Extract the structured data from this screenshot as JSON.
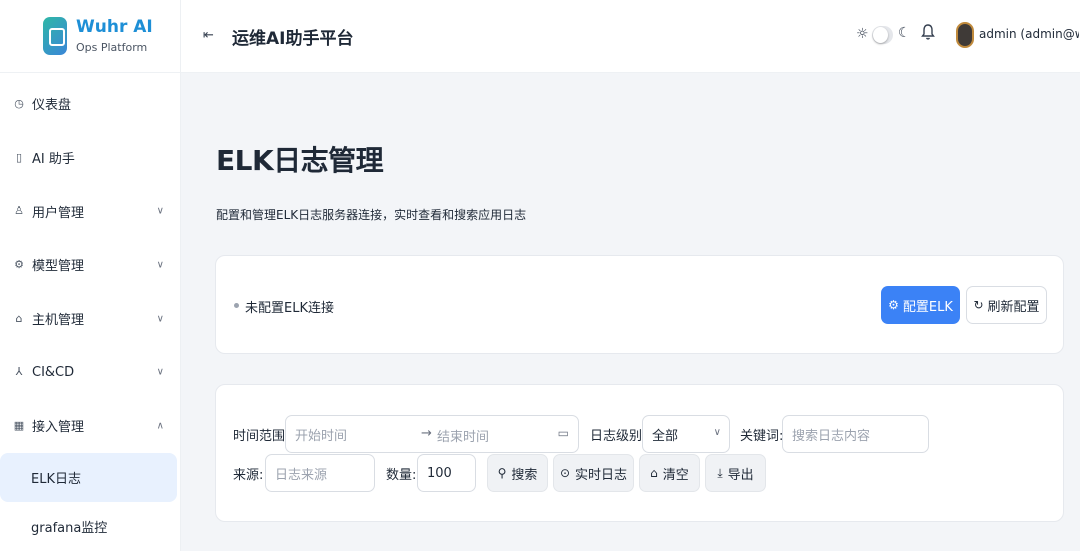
{
  "brand": {
    "title": "Wuhr AI",
    "subtitle": "Ops Platform"
  },
  "header": {
    "title": "运维AI助手平台",
    "user": "admin (admin@w..."
  },
  "sidebar": {
    "items": [
      {
        "label": "仪表盘",
        "icon": "dashboard-icon"
      },
      {
        "label": "AI 助手",
        "icon": "robot-icon"
      },
      {
        "label": "用户管理",
        "icon": "user-icon"
      },
      {
        "label": "模型管理",
        "icon": "model-icon"
      },
      {
        "label": "主机管理",
        "icon": "host-icon"
      },
      {
        "label": "CI&CD",
        "icon": "pipeline-icon"
      },
      {
        "label": "接入管理",
        "icon": "integration-icon"
      }
    ],
    "subitems": [
      {
        "label": "ELK日志",
        "active": true
      },
      {
        "label": "grafana监控",
        "active": false
      }
    ]
  },
  "page": {
    "title": "ELK日志管理",
    "subtitle": "配置和管理ELK日志服务器连接，实时查看和搜索应用日志"
  },
  "connection": {
    "status": "未配置ELK连接",
    "configure_label": "配置ELK",
    "refresh_label": "刷新配置"
  },
  "filters": {
    "time_label": "时间范围:",
    "start_placeholder": "开始时间",
    "end_placeholder": "结束时间",
    "level_label": "日志级别:",
    "level_value": "全部",
    "keyword_label": "关键词:",
    "keyword_placeholder": "搜索日志内容",
    "source_label": "来源:",
    "source_placeholder": "日志来源",
    "qty_label": "数量:",
    "qty_value": "100",
    "search_label": "搜索",
    "realtime_label": "实时日志",
    "clear_label": "清空",
    "export_label": "导出"
  }
}
